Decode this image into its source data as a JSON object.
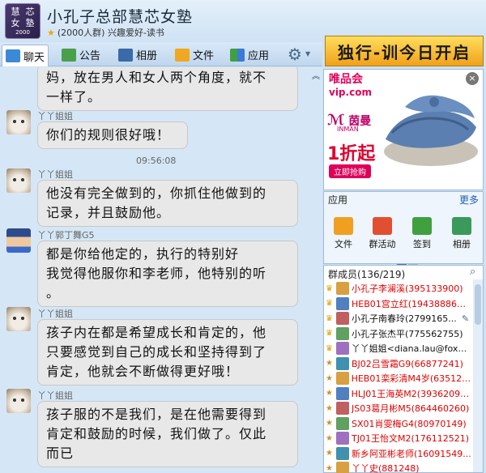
{
  "header": {
    "avatar_chars": [
      "慧",
      "芯",
      "女",
      "塾"
    ],
    "avatar_year": "2000",
    "title": "小孔子总部慧芯女塾",
    "subtitle": "(2000人群) 兴趣爱好-读书"
  },
  "toolbar": {
    "chat_label": "聊天",
    "notice_label": "公告",
    "album_label": "相册",
    "file_label": "文件",
    "app_label": "应用"
  },
  "banner": {
    "text": "独行-训今日开启"
  },
  "messages": [
    {
      "kind": "text",
      "lines": [
        "妈，放在男人和女人两个角度，就不",
        "一样了。"
      ]
    },
    {
      "kind": "sender",
      "name": "丫丫姐姐"
    },
    {
      "kind": "text",
      "lines": [
        "你们的规则很好哦！"
      ]
    },
    {
      "kind": "time",
      "value": "09:56:08"
    },
    {
      "kind": "sender",
      "name": "丫丫姐姐"
    },
    {
      "kind": "text",
      "lines": [
        "他没有完全做到的，你抓住他做到的",
        "记录，并且鼓励他。"
      ]
    },
    {
      "kind": "sender",
      "name": "丫丫郭丁舞G5"
    },
    {
      "kind": "text",
      "lines": [
        "都是你给他定的，执行的特别好",
        "我觉得他服你和李老师，他特别的听",
        "。"
      ]
    },
    {
      "kind": "sender",
      "name": "丫丫姐姐"
    },
    {
      "kind": "text",
      "lines": [
        "孩子内在都是希望成长和肯定的，他",
        "只要感觉到自己的成长和坚持得到了",
        "肯定，他就会不断做得更好哦！"
      ]
    },
    {
      "kind": "sender",
      "name": "丫丫姐姐"
    },
    {
      "kind": "text",
      "lines": [
        "孩子服的不是我们，是在他需要得到",
        "肯定和鼓励的时候，我们做了。仅此",
        "而已"
      ]
    }
  ],
  "ad": {
    "vip_line1": "唯品会",
    "vip_line2": "vip.com",
    "brand": "茵曼",
    "brand_sub": "INMAN",
    "discount": "1折起",
    "buy_label": "立即抢购"
  },
  "apps": {
    "title": "应用",
    "more": "更多",
    "items": [
      {
        "label": "文件",
        "color": "#f0a020"
      },
      {
        "label": "群活动",
        "color": "#e05030"
      },
      {
        "label": "签到",
        "color": "#40a040"
      },
      {
        "label": "相册",
        "color": "#3a9a5a"
      }
    ]
  },
  "members": {
    "header": "群成员(136/219)",
    "list": [
      {
        "name": "小孔子李澜溪(395133900)",
        "color": "#e00000",
        "role": "owner"
      },
      {
        "name": "HEB01宫立红(1943888680)",
        "color": "#e00000",
        "role": "owner"
      },
      {
        "name": "小孔子南春玲(2799165...",
        "color": "#111111",
        "role": "owner"
      },
      {
        "name": "小孔子张杰平(775562755)",
        "color": "#111111",
        "role": "owner"
      },
      {
        "name": "丫丫姐姐<diana.lau@foxm...",
        "color": "#111111",
        "role": "owner"
      },
      {
        "name": "BJ02吕雪霜G9(66877241)",
        "color": "#e00000",
        "role": "admin"
      },
      {
        "name": "HEB01栾彩清M4岁(635125...",
        "color": "#e00000",
        "role": "admin"
      },
      {
        "name": "HLJ01王海英M2(393620915)",
        "color": "#e00000",
        "role": "admin"
      },
      {
        "name": "JS03葛月彬M5(864460260)",
        "color": "#e00000",
        "role": "admin"
      },
      {
        "name": "SX01肖雯梅G4(80970149)",
        "color": "#e00000",
        "role": "admin"
      },
      {
        "name": "TJ01王怡文M2(176112521)",
        "color": "#e00000",
        "role": "admin"
      },
      {
        "name": "新乡阿亚彬老师(16091549...",
        "color": "#e00000",
        "role": "admin"
      },
      {
        "name": "丫丫史(881248)",
        "color": "#e00000",
        "role": "admin"
      }
    ]
  }
}
